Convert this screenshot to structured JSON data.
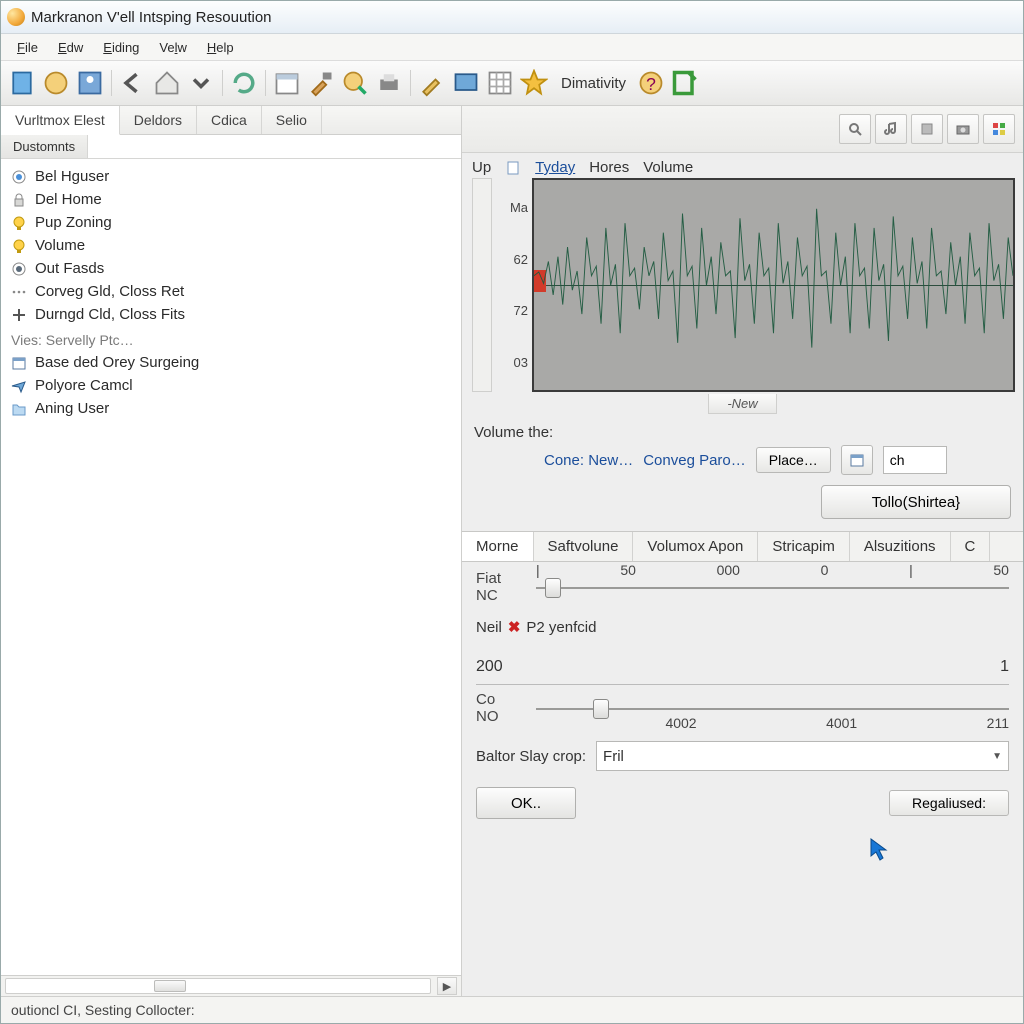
{
  "title": "Markranon V'ell Intsping Resouution",
  "menu": {
    "file": "File",
    "edw": "Edw",
    "eding": "Eiding",
    "velw": "Velw",
    "help": "Help"
  },
  "toolbar_label": "Dimativity",
  "left": {
    "tabs": [
      "Vurltmox Elest",
      "Deldors",
      "Cdica",
      "Selio"
    ],
    "subtab": "Dustomnts",
    "items": [
      {
        "icon": "radio-blue",
        "label": "Bel Hguser"
      },
      {
        "icon": "lock",
        "label": "Del Home"
      },
      {
        "icon": "bulb-yellow",
        "label": "Pup Zoning"
      },
      {
        "icon": "bulb-yellow",
        "label": "Volume"
      },
      {
        "icon": "radio-dark",
        "label": "Out Fasds"
      },
      {
        "icon": "dots",
        "label": "Corveg Gld, Closs Ret"
      },
      {
        "icon": "plus",
        "label": "Durngd Cld, Closs Fits"
      }
    ],
    "section": "Vies: Servelly Ptc…",
    "items2": [
      {
        "icon": "calendar",
        "label": "Base ded Orey Surgeing"
      },
      {
        "icon": "plane",
        "label": "Polyore Camcl"
      },
      {
        "icon": "folder",
        "label": "Aning User"
      }
    ]
  },
  "wave": {
    "header": {
      "up": "Up",
      "tyday": "Tyday",
      "hores": "Hores",
      "volume": "Volume"
    },
    "yticks": [
      "Ma",
      "62",
      "72",
      "03"
    ],
    "newtab": "-New"
  },
  "volrow": {
    "label": "Volume the:",
    "cone": "Cone: New…",
    "conveg": "Conveg Paro…",
    "place": "Place…",
    "ch": "ch"
  },
  "bigbtn": "Tollo(Shirtea}",
  "tabs2": [
    "Morne",
    "Saftvolune",
    "Volumox Apon",
    "Stricapim",
    "Alsuzitions",
    "C"
  ],
  "sliders": {
    "row1": {
      "l1": "Fiat",
      "l2": "NC",
      "ticks": [
        "|",
        "50",
        "000",
        "0",
        "|",
        "50"
      ]
    },
    "row2": {
      "label": "Neil",
      "x": "P2 yenfcid"
    },
    "num200": "200",
    "num1": "1",
    "row3": {
      "l1": "Co",
      "l2": "NO",
      "ticks": [
        "4002",
        "4001",
        "211"
      ]
    }
  },
  "baltor": {
    "label": "Baltor Slay crop:",
    "value": "Fril"
  },
  "ok": "OK..",
  "regal": "Regaliused:",
  "status": "outioncl CI, Sesting Collocter:"
}
